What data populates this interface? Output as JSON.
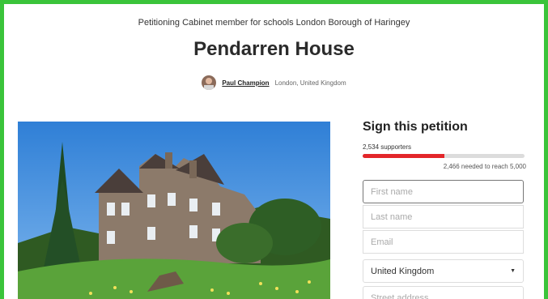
{
  "petition": {
    "target": "Petitioning Cabinet member for schools London Borough of Haringey",
    "title": "Pendarren House",
    "author_name": "Paul Champion",
    "author_location": "London, United Kingdom"
  },
  "sign": {
    "heading": "Sign this petition",
    "supporters": "2,534 supporters",
    "progress_fraction": 0.507,
    "needed": "2,466 needed to reach 5,000",
    "first_name_placeholder": "First name",
    "last_name_placeholder": "Last name",
    "email_placeholder": "Email",
    "country_value": "United Kingdom",
    "street_placeholder": "Street address"
  },
  "colors": {
    "frame_border": "#3ac43a",
    "progress_fill": "#e3262a",
    "progress_track": "#dcdcdc"
  }
}
